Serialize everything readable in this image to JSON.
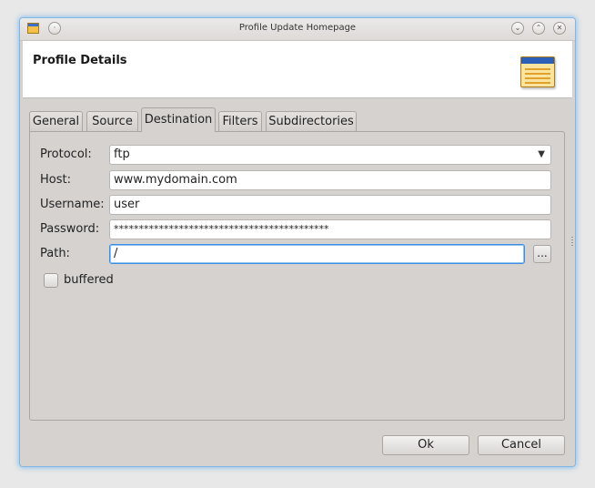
{
  "window": {
    "title": "Profile Update Homepage",
    "accent_color": "#3d8ee0",
    "title_buttons": {
      "minimize": "⌄",
      "maximize": "⌃",
      "close": "✕"
    }
  },
  "header": {
    "title": "Profile Details",
    "icon": "document-window-icon"
  },
  "tabs": [
    {
      "label": "General",
      "active": false
    },
    {
      "label": "Source",
      "active": false
    },
    {
      "label": "Destination",
      "active": true
    },
    {
      "label": "Filters",
      "active": false
    },
    {
      "label": "Subdirectories",
      "active": false
    }
  ],
  "destination": {
    "protocol": {
      "label": "Protocol:",
      "value": "ftp"
    },
    "host": {
      "label": "Host:",
      "value": "www.mydomain.com"
    },
    "username": {
      "label": "Username:",
      "value": "user"
    },
    "password": {
      "label": "Password:",
      "value": "*******************************************"
    },
    "path": {
      "label": "Path:",
      "value": "/",
      "browse_label": "..."
    },
    "buffered": {
      "label": "buffered",
      "checked": false
    }
  },
  "buttons": {
    "ok": "Ok",
    "cancel": "Cancel"
  }
}
